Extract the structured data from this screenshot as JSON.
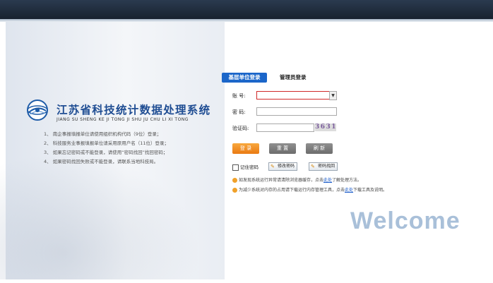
{
  "header": {},
  "brand": {
    "title_cn": "江苏省科技统计数据处理系统",
    "title_en": "JIANG SU SHENG KE JI TONG JI SHU JU CHU LI XI TONG",
    "logo_icon": "globe-logo-icon"
  },
  "tips": [
    "1、 南企事报填报单位请使用组织机构代码（9位）登录；",
    "2、 科技服务业事报填报单位请采用原用户名（11位）登录；",
    "3、 如果忘记密码或不能登录，请使用“密码找回”找回密码；",
    "4、 如果密码找回失败或不能登录，请联系当地科技局。"
  ],
  "login": {
    "tabs": [
      {
        "label": "基层单位登录",
        "active": true
      },
      {
        "label": "管理员登录",
        "active": false
      }
    ],
    "account_label": "账  号:",
    "account_value": "",
    "password_label": "密  码:",
    "password_value": "",
    "captcha_label": "验证码:",
    "captcha_value": "",
    "captcha_text": "3631",
    "login_button": "登 录",
    "reset_button": "重 置",
    "refresh_button": "刷 新",
    "remember_label": "记住密码",
    "change_password_button": "修改密码",
    "find_password_button": "密码找回",
    "notice1_pre": "如发现系统运行异常请清除浏览器缓存，点击",
    "notice1_link": "此处",
    "notice1_post": "了解处理方法。",
    "notice2_pre": "为减少系统对内存的占用请下载运行内存管理工具，点击",
    "notice2_link": "此处",
    "notice2_post": "下载工具及说明。",
    "welcome": "Welcome"
  },
  "colors": {
    "tab_active_bg": "#1b66c9",
    "title_blue": "#1f4d93",
    "login_orange": "#ea7a12",
    "gray_button": "#7a7a7a"
  }
}
